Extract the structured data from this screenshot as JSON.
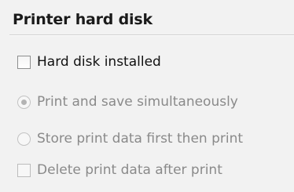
{
  "group": {
    "title": "Printer hard disk"
  },
  "options": {
    "hard_disk_installed": {
      "label": "Hard disk installed",
      "checked": false,
      "enabled": true
    },
    "print_and_save": {
      "label": "Print and save simultaneously",
      "selected": true,
      "enabled": false
    },
    "store_first": {
      "label": "Store print data first then print",
      "selected": false,
      "enabled": false
    },
    "delete_after": {
      "label": "Delete print data after print",
      "checked": false,
      "enabled": false
    }
  },
  "colors": {
    "enabled_text": "#111111",
    "disabled_text": "#8a8a8a",
    "background": "#f2f2f2"
  }
}
